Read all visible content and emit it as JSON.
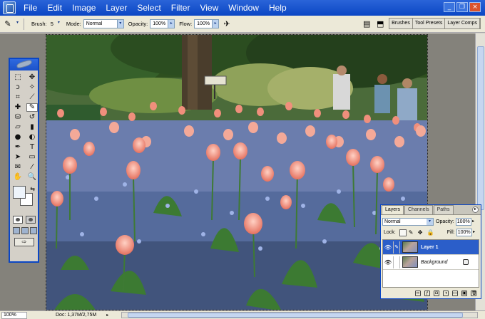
{
  "menubar": {
    "items": [
      "File",
      "Edit",
      "Image",
      "Layer",
      "Select",
      "Filter",
      "View",
      "Window",
      "Help"
    ],
    "window_buttons": [
      "_",
      "❐",
      "×"
    ]
  },
  "options_bar": {
    "tool_icon": "brush-icon",
    "brush_label": "Brush:",
    "brush_size": "5",
    "mode_label": "Mode:",
    "mode_value": "Normal",
    "opacity_label": "Opacity:",
    "opacity_value": "100%",
    "flow_label": "Flow:",
    "flow_value": "100%",
    "airbrush_icon": "airbrush-icon",
    "well_tabs": [
      "Brushes",
      "Tool Presets",
      "Layer Comps"
    ]
  },
  "toolbox": {
    "tools": [
      "marquee-icon",
      "move-icon",
      "lasso-icon",
      "magic-wand-icon",
      "crop-icon",
      "slice-icon",
      "healing-icon",
      "brush-icon",
      "stamp-icon",
      "history-brush-icon",
      "eraser-icon",
      "gradient-icon",
      "blur-icon",
      "dodge-icon",
      "pen-icon",
      "type-icon",
      "path-select-icon",
      "shape-icon",
      "notes-icon",
      "eyedropper-icon",
      "hand-icon",
      "zoom-icon"
    ],
    "tool_glyphs": [
      "⬚",
      "✥",
      "ↄ",
      "✧",
      "⌗",
      "⟋",
      "✚",
      "✎",
      "⛁",
      "↺",
      "▱",
      "▮",
      "●",
      "◐",
      "✒",
      "T",
      "➤",
      "▭",
      "✉",
      "⁄",
      "✋",
      "🔍"
    ],
    "active_tool": 7
  },
  "layers_palette": {
    "tabs": [
      "Layers",
      "Channels",
      "Paths"
    ],
    "blend_mode": "Normal",
    "opacity_label": "Opacity:",
    "opacity_value": "100%",
    "lock_label": "Lock:",
    "fill_label": "Fill:",
    "fill_value": "100%",
    "layers": [
      {
        "name": "Layer 1",
        "active": true
      },
      {
        "name": "Background",
        "active": false
      }
    ]
  },
  "statusbar": {
    "zoom": "100%",
    "doc": "Doc: 1,37M/2,75M"
  },
  "colors": {
    "title_blue": "#0b46c4",
    "selection_blue": "#2b5ec9",
    "chrome": "#ece9d8",
    "workspace": "#84827b"
  }
}
